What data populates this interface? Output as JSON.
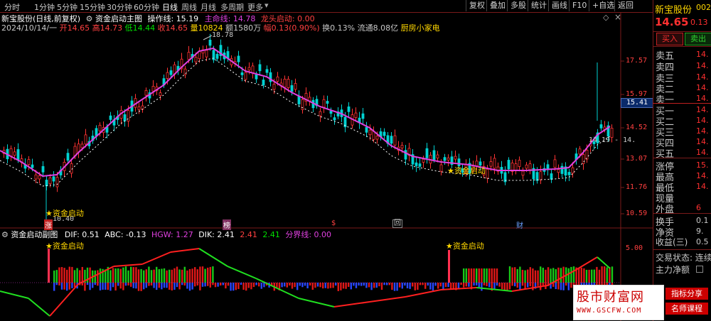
{
  "toolbar": {
    "tabs": [
      "分时",
      "1分钟",
      "5分钟",
      "15分钟",
      "30分钟",
      "60分钟",
      "日线",
      "周线",
      "月线",
      "多周期",
      "更多"
    ],
    "active_tab": "日线",
    "right_buttons": [
      "复权",
      "叠加",
      "多股",
      "统计",
      "画线",
      "F10",
      "+自选",
      "返回"
    ]
  },
  "header": {
    "stock_line": "新宝股份(日线,前复权)",
    "indicator_name": "资金启动主图",
    "op_line_label": "操作线:",
    "op_line_value": "15.19",
    "life_line": "主命线: 14.78",
    "dragon_start": "龙头启动: 0.00",
    "date": "2024/10/14/一",
    "open": "开14.65",
    "high": "高14.73",
    "low": "低14.44",
    "close": "收14.65",
    "volume": "量10824",
    "amount": "额1580万",
    "change": "幅0.13(0.90%)",
    "turnover": "换0.13%",
    "float": "流通8.08亿",
    "sector": "厨房小家电"
  },
  "price_axis": [
    "17.57",
    "15.97",
    "14.52",
    "13.07",
    "11.76",
    "10.59"
  ],
  "current_price_tag": "15.41",
  "annotations": {
    "peak": "18.78",
    "low": "10.40",
    "range_right": "14.19 - 14.",
    "start_label": "资金启动",
    "event_marks": [
      "涨",
      "榜",
      "$",
      "回",
      "财"
    ]
  },
  "sub_header": {
    "name": "资金启动副图",
    "dif": "DIF: 0.51",
    "abc": "ABC: -0.13",
    "hgw": "HGW: 1.27",
    "dik": "DIK: 2.41",
    "v5": "2.41",
    "v6": "2.41",
    "boundary": "分界线: 0.00",
    "axis_value": "5.00"
  },
  "right_panel": {
    "name": "新宝股份",
    "code": "002",
    "price": "14.65",
    "change": "0.13",
    "buy_btn": "买入",
    "sell_btn": "卖出",
    "asks": [
      {
        "label": "卖五",
        "value": "14."
      },
      {
        "label": "卖四",
        "value": "14."
      },
      {
        "label": "卖三",
        "value": "14."
      },
      {
        "label": "卖二",
        "value": "14."
      },
      {
        "label": "卖一",
        "value": "14."
      }
    ],
    "bids": [
      {
        "label": "买一",
        "value": "14."
      },
      {
        "label": "买二",
        "value": "14."
      },
      {
        "label": "买三",
        "value": "14."
      },
      {
        "label": "买四",
        "value": "14."
      },
      {
        "label": "买五",
        "value": "14."
      }
    ],
    "stats": [
      {
        "label": "涨停",
        "value": "15."
      },
      {
        "label": "最高",
        "value": "14."
      },
      {
        "label": "最低",
        "value": "14."
      },
      {
        "label": "现量",
        "value": ""
      },
      {
        "label": "外盘",
        "value": "6"
      }
    ],
    "stats2": [
      {
        "label": "换手",
        "value": "0.1"
      },
      {
        "label": "净资",
        "value": "9."
      },
      {
        "label": "收益(三)",
        "value": "0.5"
      }
    ],
    "trade_status": "交易状态: 连续",
    "main_net": "主力净额"
  },
  "watermark": {
    "site": "股市财富网",
    "url": "WWW.GSCFW.COM",
    "tag1": "指标分享",
    "tag2": "名师课程"
  },
  "colors": {
    "up": "#ff3333",
    "down": "#00d2d2",
    "ma": "#e040e0",
    "accent_red": "#ff2020",
    "yellow": "#ffd700"
  }
}
